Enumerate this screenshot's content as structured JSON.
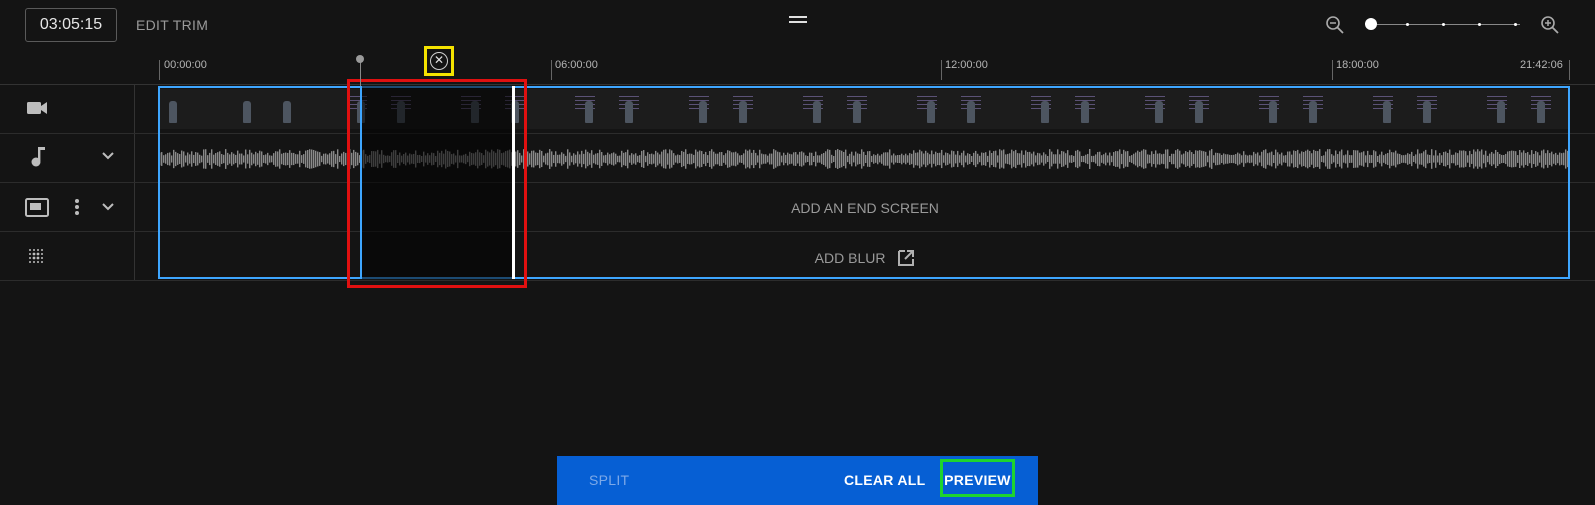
{
  "header": {
    "timecode": "03:05:15",
    "edit_trim_label": "EDIT TRIM"
  },
  "ruler": {
    "ticks": [
      "00:00:00",
      "06:00:00",
      "12:00:00",
      "18:00:00",
      "21:42:06"
    ]
  },
  "tracks": {
    "end_screen_label": "ADD AN END SCREEN",
    "blur_label": "ADD BLUR"
  },
  "icons": {
    "video": "video-camera-icon",
    "audio": "music-note-icon",
    "end_screen": "end-screen-icon",
    "blur": "blur-icon",
    "zoom_out": "zoom-out-icon",
    "zoom_in": "zoom-in-icon",
    "remove_cut": "close-circle-icon",
    "external": "open-in-new-icon"
  },
  "zoom": {
    "level_fraction": 0.0
  },
  "colors": {
    "accent": "#3ea6ff",
    "bar": "#065fd4",
    "highlight_red": "#e01010",
    "highlight_yellow": "#f5e300",
    "highlight_green": "#1ed42f"
  },
  "footer": {
    "split_label": "SPLIT",
    "clear_all_label": "CLEAR ALL",
    "preview_label": "PREVIEW"
  }
}
